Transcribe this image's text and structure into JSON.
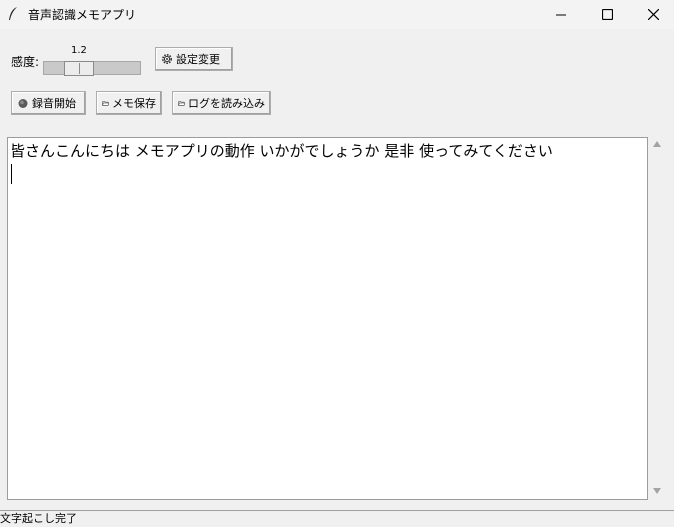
{
  "window": {
    "title": "音声認識メモアプリ",
    "controls": [
      "minimize-icon",
      "maximize-icon",
      "close-icon"
    ]
  },
  "sensitivity": {
    "label": "感度:",
    "value": "1.2",
    "level_fraction": 0.3
  },
  "buttons": {
    "settings": "設定変更",
    "record": "録音開始",
    "save_memo": "メモ保存",
    "load_log": "ログを読み込み"
  },
  "icons": {
    "settings": "gear-icon",
    "record": "record-dot-icon",
    "save_memo": "folder-icon",
    "load_log": "folder-icon"
  },
  "transcript": {
    "text": "皆さんこんにちは メモアプリの動作 いかがでしょうか 是非 使ってみてください"
  },
  "status": {
    "text": "文字起こし完了"
  }
}
